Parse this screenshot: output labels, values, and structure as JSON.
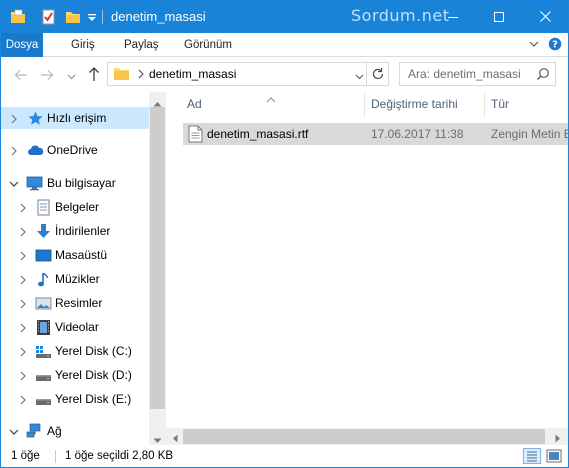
{
  "window": {
    "title": "denetim_masasi",
    "watermark": "Sordum.net",
    "accent_color": "#1883d7"
  },
  "quick_access_toolbar": [
    "folder-icon",
    "properties-icon",
    "new-folder-icon",
    "chevron-down-icon"
  ],
  "ribbon": {
    "tabs": [
      "Dosya",
      "Giriş",
      "Paylaş",
      "Görünüm"
    ]
  },
  "address_bar": {
    "path": "denetim_masasi"
  },
  "search": {
    "placeholder": "Ara: denetim_masasi"
  },
  "nav_pane": {
    "quick_access": "Hızlı erişim",
    "onedrive": "OneDrive",
    "this_pc": "Bu bilgisayar",
    "items": [
      {
        "label": "Belgeler",
        "icon": "documents-icon"
      },
      {
        "label": "İndirilenler",
        "icon": "downloads-icon"
      },
      {
        "label": "Masaüstü",
        "icon": "desktop-icon"
      },
      {
        "label": "Müzikler",
        "icon": "music-icon"
      },
      {
        "label": "Resimler",
        "icon": "pictures-icon"
      },
      {
        "label": "Videolar",
        "icon": "videos-icon"
      },
      {
        "label": "Yerel Disk (C:)",
        "icon": "system-drive-icon"
      },
      {
        "label": "Yerel Disk (D:)",
        "icon": "drive-icon"
      },
      {
        "label": "Yerel Disk (E:)",
        "icon": "drive-icon"
      }
    ],
    "network": "Ağ"
  },
  "file_list": {
    "columns": {
      "name": "Ad",
      "date": "Değiştirme tarihi",
      "type": "Tür"
    },
    "rows": [
      {
        "name": "denetim_masasi.rtf",
        "date": "17.06.2017 11:38",
        "type": "Zengin Metin Biçimi"
      }
    ]
  },
  "status_bar": {
    "count": "1 öğe",
    "selection": "1 öğe seçildi  2,80 KB"
  }
}
